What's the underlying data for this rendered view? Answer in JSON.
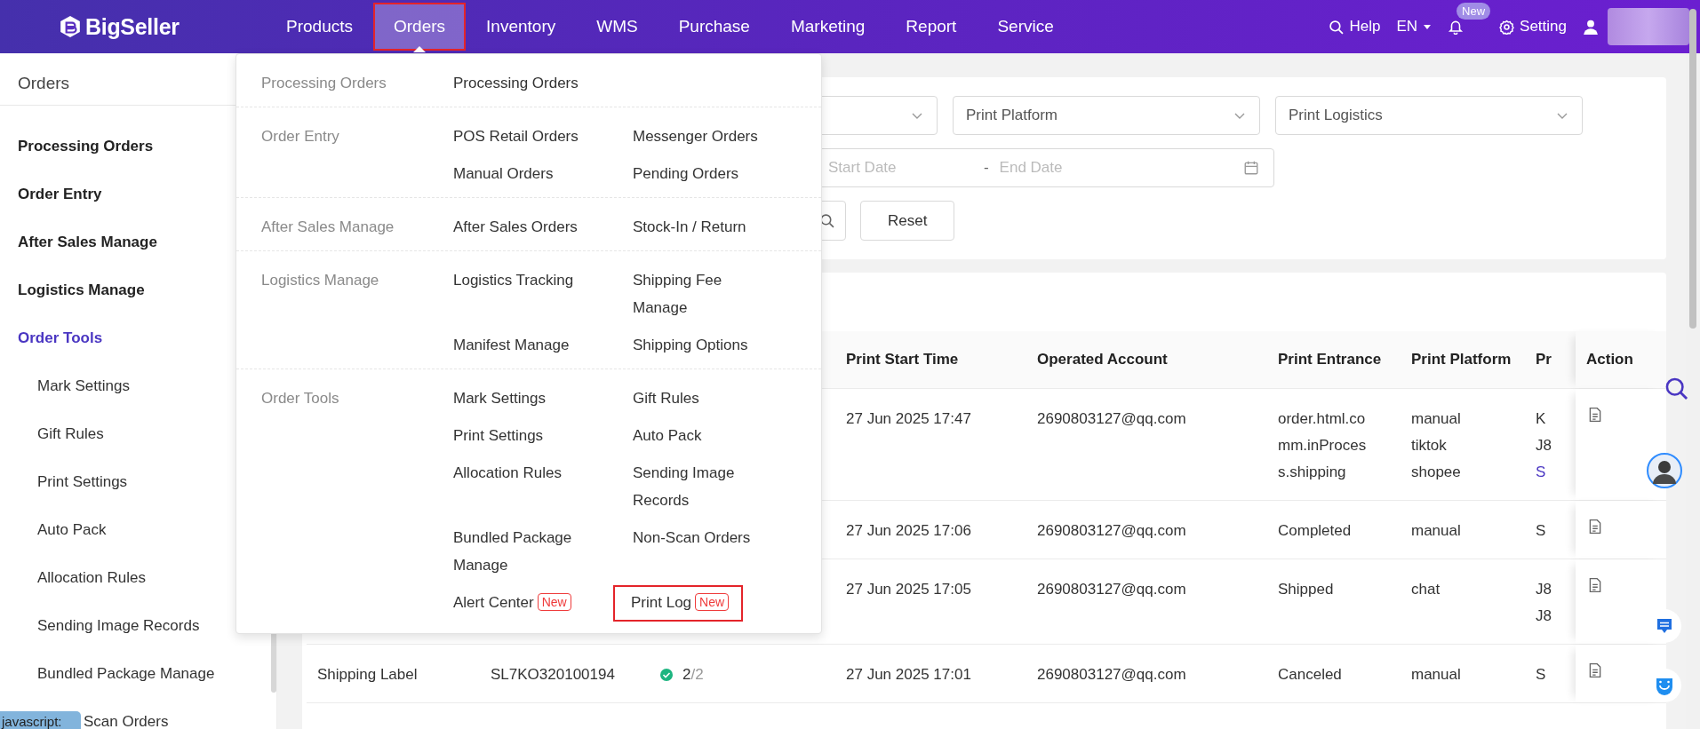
{
  "topbar": {
    "logo": "BigSeller",
    "nav": [
      {
        "label": "Products",
        "selected": false,
        "highlighted": false
      },
      {
        "label": "Orders",
        "selected": true,
        "highlighted": true
      },
      {
        "label": "Inventory",
        "selected": false,
        "highlighted": false
      },
      {
        "label": "WMS",
        "selected": false,
        "highlighted": false
      },
      {
        "label": "Purchase",
        "selected": false,
        "highlighted": false
      },
      {
        "label": "Marketing",
        "selected": false,
        "highlighted": false
      },
      {
        "label": "Report",
        "selected": false,
        "highlighted": false
      },
      {
        "label": "Service",
        "selected": false,
        "highlighted": false
      }
    ],
    "help": "Help",
    "language": "EN",
    "notification_badge": "New",
    "setting": "Setting"
  },
  "sidebar": {
    "title": "Orders",
    "items": [
      {
        "label": "Processing Orders",
        "selected": false
      },
      {
        "label": "Order Entry",
        "selected": false
      },
      {
        "label": "After Sales Manage",
        "selected": false
      },
      {
        "label": "Logistics Manage",
        "selected": false
      },
      {
        "label": "Order Tools",
        "selected": true,
        "children": [
          {
            "label": "Mark Settings",
            "kind": "full"
          },
          {
            "label": "Gift Rules",
            "kind": "full"
          },
          {
            "label": "Print Settings",
            "kind": "full"
          },
          {
            "label": "Auto Pack",
            "kind": "full"
          },
          {
            "label": "Allocation Rules",
            "kind": "full"
          },
          {
            "label": "Sending Image Records",
            "kind": "full"
          },
          {
            "label": "Bundled Package Manage",
            "kind": "full"
          },
          {
            "label": "Scan Orders",
            "kind": "partial"
          }
        ]
      }
    ]
  },
  "mega_menu": {
    "groups": [
      {
        "label": "Processing Orders",
        "items": [
          {
            "label": "Processing Orders",
            "highlighted": false
          }
        ]
      },
      {
        "label": "Order Entry",
        "items": [
          {
            "label": "POS Retail Orders",
            "highlighted": false
          },
          {
            "label": "Messenger Orders",
            "highlighted": false
          },
          {
            "label": "Manual Orders",
            "highlighted": false
          },
          {
            "label": "Pending Orders",
            "highlighted": false
          }
        ]
      },
      {
        "label": "After Sales Manage",
        "items": [
          {
            "label": "After Sales Orders",
            "highlighted": false
          },
          {
            "label": "Stock-In / Return",
            "highlighted": false
          }
        ]
      },
      {
        "label": "Logistics Manage",
        "items": [
          {
            "label": "Logistics Tracking",
            "highlighted": false
          },
          {
            "label": "Shipping Fee Manage",
            "highlighted": false
          },
          {
            "label": "Manifest Manage",
            "highlighted": false
          },
          {
            "label": "Shipping Options",
            "highlighted": false
          }
        ]
      },
      {
        "label": "Order Tools",
        "items": [
          {
            "label": "Mark Settings",
            "highlighted": false
          },
          {
            "label": "Gift Rules",
            "highlighted": false
          },
          {
            "label": "Print Settings",
            "highlighted": false
          },
          {
            "label": "Auto Pack",
            "highlighted": false
          },
          {
            "label": "Allocation Rules",
            "highlighted": false
          },
          {
            "label": "Sending Image Records",
            "highlighted": false
          },
          {
            "label": "Bundled Package Manage",
            "highlighted": false
          },
          {
            "label": "Non-Scan Orders",
            "highlighted": false
          },
          {
            "label": "Alert Center",
            "badge": "New",
            "highlighted": false
          },
          {
            "label": "Print Log",
            "badge": "New",
            "highlighted": true
          }
        ]
      }
    ]
  },
  "filters": {
    "selects": [
      {
        "placeholder": "Print Platform"
      },
      {
        "placeholder": "Print Logistics"
      }
    ],
    "date_range": {
      "start_placeholder": "Start Date",
      "separator": "-",
      "end_placeholder": "End Date"
    },
    "reset_button": "Reset"
  },
  "table": {
    "columns": [
      "Print Start Time",
      "Operated Account",
      "Print Entrance",
      "Print Platform",
      "Pr",
      "Action"
    ],
    "rows": [
      {
        "cells": [
          "27 Jun 2025 17:47",
          "2690803127@qq.com",
          "order.html.comm.inProcess.shipping",
          [
            "manual",
            "tiktok",
            "shopee"
          ],
          [
            {
              "text": "K",
              "link": false
            },
            {
              "text": "J8",
              "link": false
            },
            {
              "text": "S",
              "link": true
            }
          ]
        ]
      },
      {
        "cells": [
          "27 Jun 2025 17:06",
          "2690803127@qq.com",
          "Completed",
          [
            "manual"
          ],
          [
            {
              "text": "S",
              "link": false
            }
          ]
        ]
      },
      {
        "cells": [
          "27 Jun 2025 17:05",
          "2690803127@qq.com",
          "Shipped",
          [
            "chat"
          ],
          [
            {
              "text": "J8",
              "link": false
            },
            {
              "text": "J8",
              "link": false
            }
          ]
        ]
      },
      {
        "lead": {
          "type": "Shipping Label",
          "tracking": "SL7KO320100194",
          "progress": {
            "complete": true,
            "done": "2",
            "total": "/2"
          }
        },
        "cells": [
          "27 Jun 2025 17:01",
          "2690803127@qq.com",
          "Canceled",
          [
            "manual"
          ],
          [
            {
              "text": "S",
              "link": false
            }
          ]
        ]
      }
    ]
  },
  "status_tooltip": "javascript:"
}
